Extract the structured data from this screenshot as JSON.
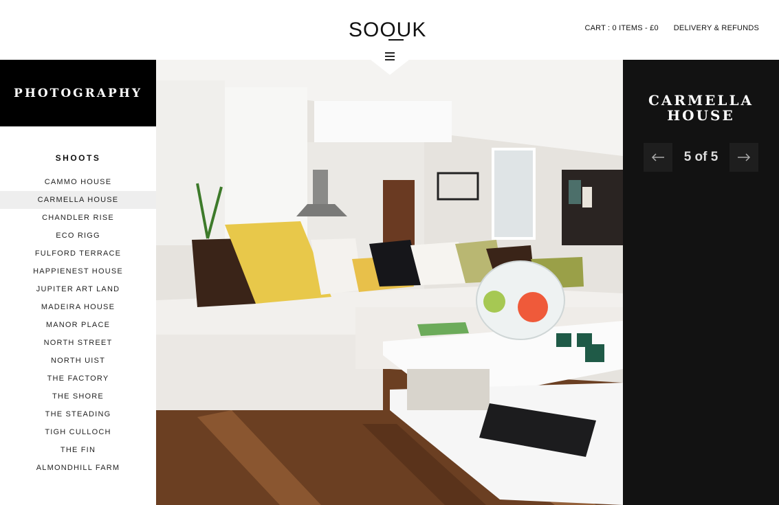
{
  "header": {
    "logo_text": "SOOUK",
    "cart_label": "CART : 0 ITEMS - ",
    "cart_amount": "£0",
    "delivery_label": "DELIVERY & REFUNDS"
  },
  "sidebar": {
    "section_title": "PHOTOGRAPHY",
    "shoots_heading": "SHOOTS",
    "items": [
      {
        "label": "CAMMO HOUSE"
      },
      {
        "label": "CARMELLA HOUSE"
      },
      {
        "label": "CHANDLER RISE"
      },
      {
        "label": "ECO RIGG"
      },
      {
        "label": "FULFORD TERRACE"
      },
      {
        "label": "HAPPIENEST HOUSE"
      },
      {
        "label": "JUPITER ART LAND"
      },
      {
        "label": "MADEIRA HOUSE"
      },
      {
        "label": "MANOR PLACE"
      },
      {
        "label": "NORTH STREET"
      },
      {
        "label": "NORTH UIST"
      },
      {
        "label": "THE FACTORY"
      },
      {
        "label": "THE SHORE"
      },
      {
        "label": "THE STEADING"
      },
      {
        "label": "TIGH CULLOCH"
      },
      {
        "label": "THE FIN"
      },
      {
        "label": "ALMONDHILL FARM"
      }
    ],
    "active_index": 1
  },
  "info_panel": {
    "title_line1": "CARMELLA",
    "title_line2": "HOUSE",
    "prev_icon": "arrow-left-icon",
    "next_icon": "arrow-right-icon",
    "pager_text": "5 of 5"
  },
  "colors": {
    "black": "#000000",
    "panel": "#121212",
    "active_row": "#eeeeee",
    "pillow_yellow": "#e8c84a",
    "wood": "#7a4a28"
  }
}
